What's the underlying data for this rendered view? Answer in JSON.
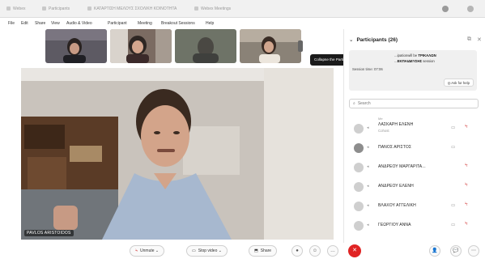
{
  "browser": {
    "tabs": [
      {
        "label": "Webex"
      },
      {
        "label": "Participants"
      },
      {
        "label": "ΚΑΤΑΡΤΙΣΗ ΜΕΛΟΥΣ ΣΧΟΛΙΚΗ ΚΟΙΝΟΤΗΤΑ"
      },
      {
        "label": "Webex Meetings"
      }
    ]
  },
  "menubar": {
    "items": [
      {
        "label": "File"
      },
      {
        "label": "Edit"
      },
      {
        "label": "Share"
      },
      {
        "label": "View"
      },
      {
        "label": "Audio & Video"
      },
      {
        "label": "Participant"
      },
      {
        "label": "Meeting"
      },
      {
        "label": "Breakout Sessions"
      },
      {
        "label": "Help"
      }
    ]
  },
  "stage": {
    "speaker_name": "PAVLOS ARISTOIDOS"
  },
  "tooltip": {
    "text": "Collapse the Participants panel"
  },
  "participants_panel": {
    "title": "Participants (26)",
    "notice_line1": "...ipationwill be ",
    "notice_bold1": "ΤΡΙΚΑΛΩΝ",
    "notice_line2": "...",
    "notice_bold2": "ΕΚΠΑΙΔΕΥΣΗΣ",
    "notice_tail": " session",
    "session_time": "Session time: 07:06",
    "ask_button": "Ask for help",
    "search_placeholder": "Search",
    "list_header": "Me",
    "participants": [
      {
        "name": "ΛΑΣΚΑΡΗ ΕΛΕΝΗ",
        "subtitle": "Cohost",
        "avatar": "light",
        "muted": true
      },
      {
        "name": "ΠΑΝΟΣ ΑΡΙΣΤΟΣ",
        "subtitle": "",
        "avatar": "dark",
        "muted": false
      },
      {
        "name": "ΑΝΔΡΕΟΥ ΜΑΡΓΑΡΙΤΑ...",
        "subtitle": "",
        "avatar": "light",
        "muted": true
      },
      {
        "name": "ΑΝΔΡΕΟΥ ΕΛΕΝΗ",
        "subtitle": "",
        "avatar": "light",
        "muted": true
      },
      {
        "name": "ΒΛΑΧΟΥ ΑΓΓΕΛΙΚΗ",
        "subtitle": "",
        "avatar": "light",
        "muted": true
      },
      {
        "name": "ΓΕΩΡΓΙΟΥ ΑΝΝΑ",
        "subtitle": "",
        "avatar": "light",
        "muted": true
      }
    ]
  },
  "bottom_controls": {
    "unmute": "Unmute",
    "stop_video": "Stop video",
    "share": "Share"
  },
  "colors": {
    "mic_muted": "#d23b3b",
    "leave": "#e02424"
  }
}
